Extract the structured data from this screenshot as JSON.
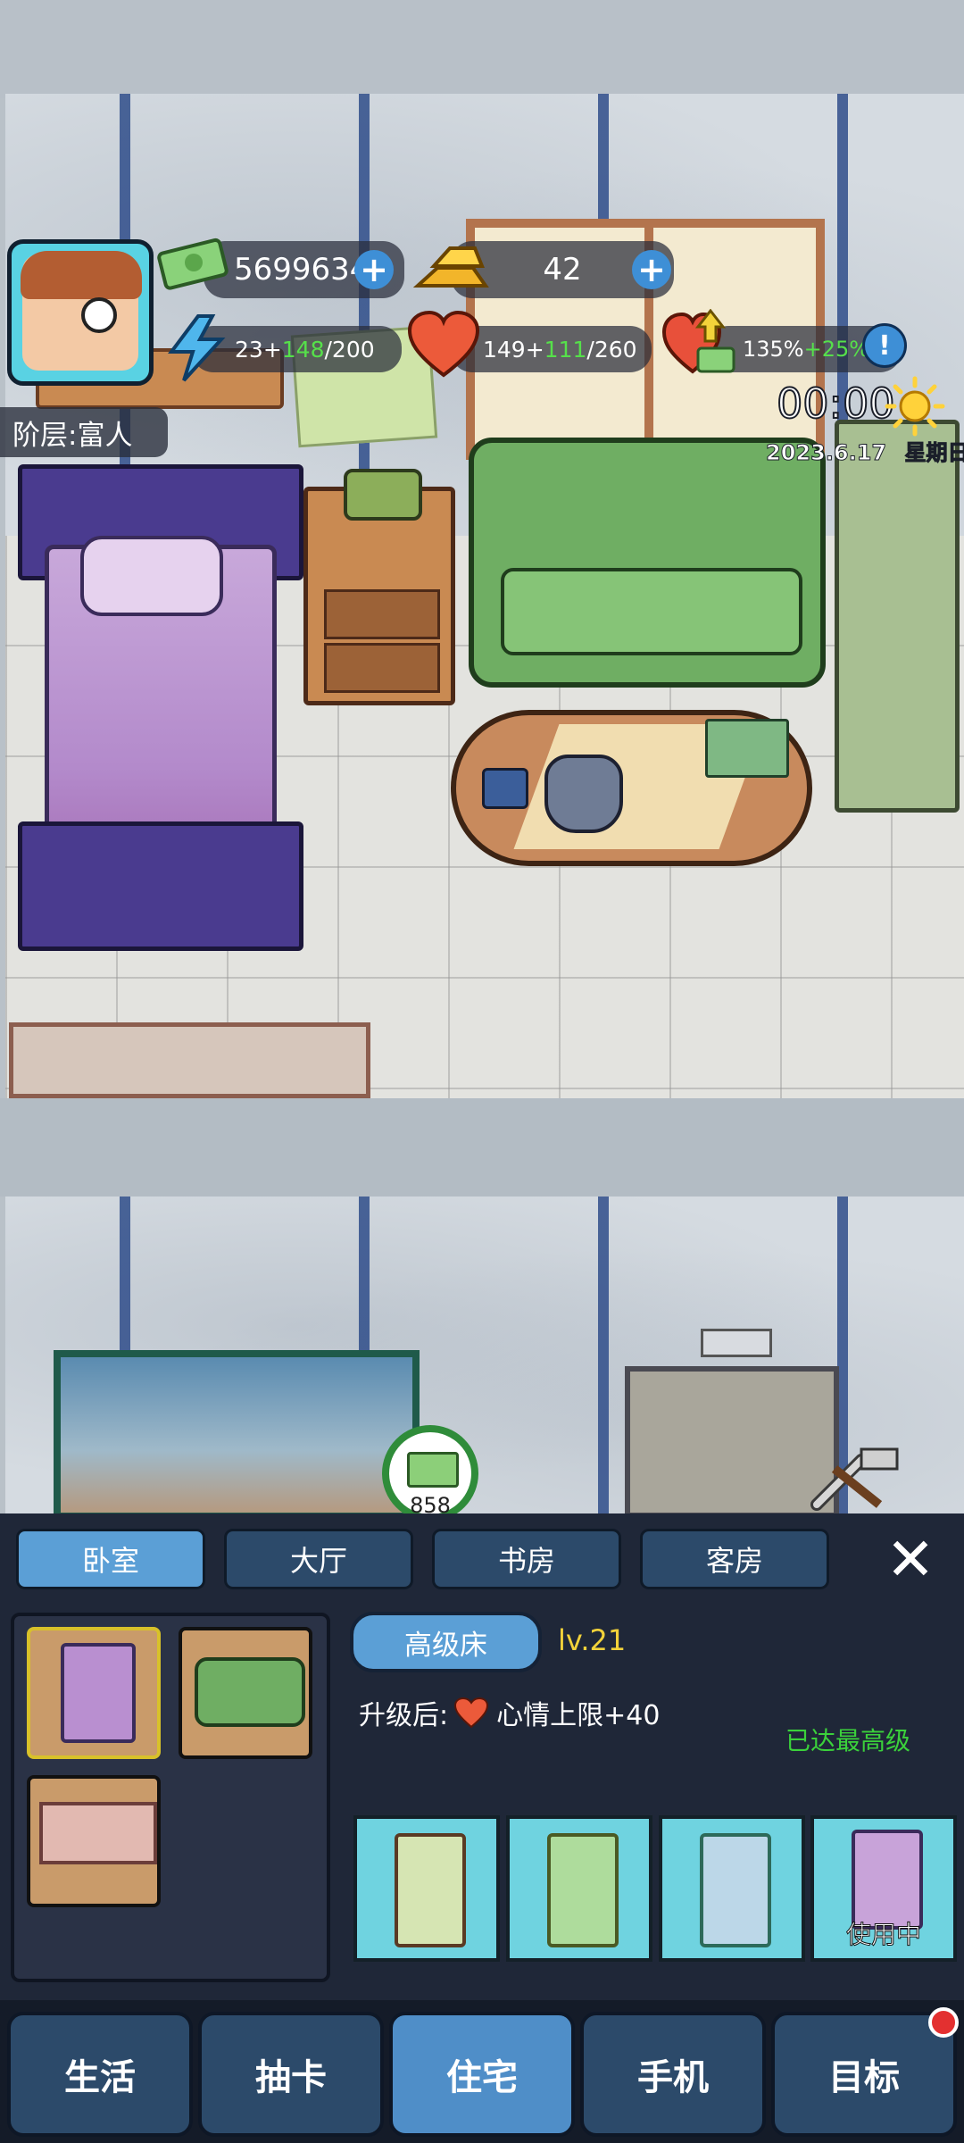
{
  "hud": {
    "money": "5699634",
    "gold": "42",
    "energy": {
      "base": "23",
      "plus": "148",
      "max": "200",
      "plus_sign": "+",
      "slash": "/"
    },
    "health": {
      "base": "149",
      "plus": "111",
      "max": "260",
      "plus_sign": "+",
      "slash": "/"
    },
    "mood": {
      "value": "135%",
      "bonus": "+25%",
      "alert": "!"
    },
    "time": "00:00",
    "date": "2023.6.17",
    "weekday": "星期日",
    "class_label": "阶层:富人",
    "income_bubble": "858"
  },
  "room_tabs": [
    "卧室",
    "大厅",
    "书房",
    "客房"
  ],
  "active_room_tab": 0,
  "close_glyph": "✕",
  "furniture": {
    "name": "高级床",
    "level": "lv.21",
    "upgrade_prefix": "升级后:",
    "upgrade_effect": "心情上限+40",
    "max_level": "已达最高级",
    "in_use": "使用中"
  },
  "nav": [
    "生活",
    "抽卡",
    "住宅",
    "手机",
    "目标"
  ],
  "active_nav": 2,
  "colors": {
    "accent": "#5b9fd6",
    "positive": "#56e04a",
    "max_level": "#3bd13b",
    "badge": "#e33030"
  }
}
